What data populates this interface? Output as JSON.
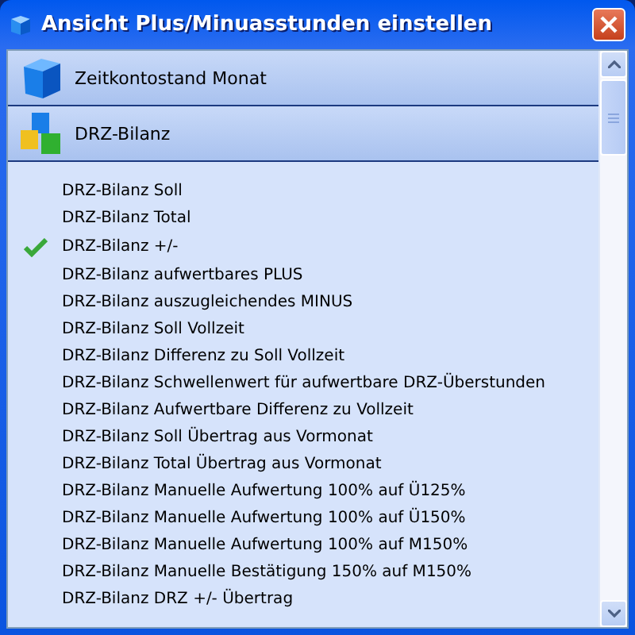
{
  "window": {
    "title": "Ansicht Plus/Minuasstunden einstellen"
  },
  "sections": [
    {
      "label": "Zeitkontostand Monat",
      "kind": "single"
    },
    {
      "label": "DRZ-Bilanz",
      "kind": "multi"
    }
  ],
  "items": [
    {
      "label": "DRZ-Bilanz Soll",
      "checked": false
    },
    {
      "label": "DRZ-Bilanz Total",
      "checked": false
    },
    {
      "label": "DRZ-Bilanz +/-",
      "checked": true
    },
    {
      "label": "DRZ-Bilanz aufwertbares PLUS",
      "checked": false
    },
    {
      "label": "DRZ-Bilanz auszugleichendes MINUS",
      "checked": false
    },
    {
      "label": "DRZ-Bilanz Soll Vollzeit",
      "checked": false
    },
    {
      "label": "DRZ-Bilanz Differenz zu Soll Vollzeit",
      "checked": false
    },
    {
      "label": "DRZ-Bilanz Schwellenwert für aufwertbare DRZ-Überstunden",
      "checked": false
    },
    {
      "label": "DRZ-Bilanz Aufwertbare Differenz zu Vollzeit",
      "checked": false
    },
    {
      "label": "DRZ-Bilanz Soll Übertrag aus Vormonat",
      "checked": false
    },
    {
      "label": "DRZ-Bilanz Total Übertrag aus Vormonat",
      "checked": false
    },
    {
      "label": "DRZ-Bilanz Manuelle Aufwertung 100% auf Ü125%",
      "checked": false
    },
    {
      "label": "DRZ-Bilanz Manuelle Aufwertung 100% auf Ü150%",
      "checked": false
    },
    {
      "label": "DRZ-Bilanz Manuelle Aufwertung 100% auf M150%",
      "checked": false
    },
    {
      "label": "DRZ-Bilanz Manuelle Bestätigung 150% auf M150%",
      "checked": false
    },
    {
      "label": "DRZ-Bilanz DRZ +/- Übertrag",
      "checked": false
    }
  ]
}
